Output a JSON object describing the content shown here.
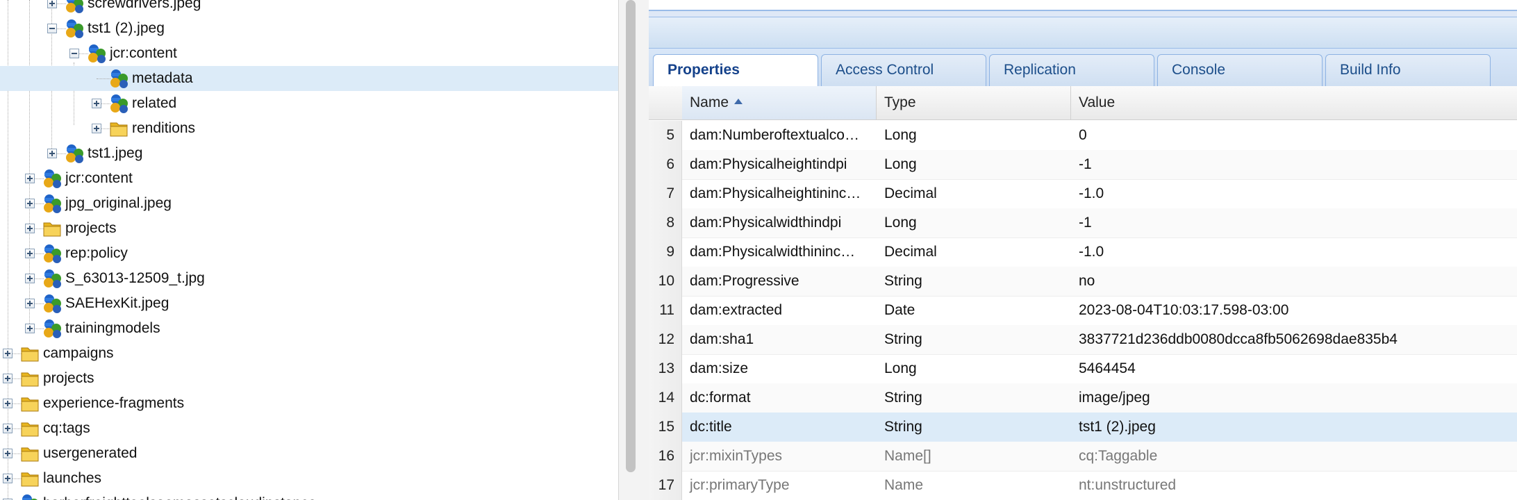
{
  "tree": [
    {
      "label": "screwdrivers.jpeg",
      "icon": "node-icon",
      "toggle": "plus"
    },
    {
      "label": "tst1 (2).jpeg",
      "icon": "node-icon",
      "toggle": "minus"
    },
    {
      "label": "jcr:content",
      "icon": "node-icon",
      "toggle": "minus"
    },
    {
      "label": "metadata",
      "icon": "node-icon",
      "toggle": "none",
      "selected": true
    },
    {
      "label": "related",
      "icon": "node-icon",
      "toggle": "plus"
    },
    {
      "label": "renditions",
      "icon": "folder-icon",
      "toggle": "plus"
    },
    {
      "label": "tst1.jpeg",
      "icon": "node-icon",
      "toggle": "plus"
    },
    {
      "label": "jcr:content",
      "icon": "node-icon",
      "toggle": "plus"
    },
    {
      "label": "jpg_original.jpeg",
      "icon": "node-icon",
      "toggle": "plus"
    },
    {
      "label": "projects",
      "icon": "folder-icon",
      "toggle": "plus"
    },
    {
      "label": "rep:policy",
      "icon": "node-icon",
      "toggle": "plus"
    },
    {
      "label": "S_63013-12509_t.jpg",
      "icon": "node-icon",
      "toggle": "plus"
    },
    {
      "label": "SAEHexKit.jpeg",
      "icon": "node-icon",
      "toggle": "plus"
    },
    {
      "label": "trainingmodels",
      "icon": "node-icon",
      "toggle": "plus"
    },
    {
      "label": "campaigns",
      "icon": "folder-icon",
      "toggle": "plus"
    },
    {
      "label": "projects",
      "icon": "folder-icon",
      "toggle": "plus"
    },
    {
      "label": "experience-fragments",
      "icon": "folder-icon",
      "toggle": "plus"
    },
    {
      "label": "cq:tags",
      "icon": "folder-icon",
      "toggle": "plus"
    },
    {
      "label": "usergenerated",
      "icon": "folder-icon",
      "toggle": "plus"
    },
    {
      "label": "launches",
      "icon": "folder-icon",
      "toggle": "plus"
    },
    {
      "label": "harborfreighttoolsaemassetscloudinstance",
      "icon": "node-icon",
      "toggle": "plus"
    }
  ],
  "tabs": [
    {
      "label": "Properties",
      "active": true
    },
    {
      "label": "Access Control",
      "active": false
    },
    {
      "label": "Replication",
      "active": false
    },
    {
      "label": "Console",
      "active": false
    },
    {
      "label": "Build Info",
      "active": false
    }
  ],
  "grid": {
    "columns": {
      "name": "Name",
      "type": "Type",
      "value": "Value"
    },
    "rows": [
      {
        "n": "5",
        "name": "dam:Numberoftextualco…",
        "type": "Long",
        "value": "0"
      },
      {
        "n": "6",
        "name": "dam:Physicalheightindpi",
        "type": "Long",
        "value": "-1"
      },
      {
        "n": "7",
        "name": "dam:Physicalheightininc…",
        "type": "Decimal",
        "value": "-1.0"
      },
      {
        "n": "8",
        "name": "dam:Physicalwidthindpi",
        "type": "Long",
        "value": "-1"
      },
      {
        "n": "9",
        "name": "dam:Physicalwidthininc…",
        "type": "Decimal",
        "value": "-1.0"
      },
      {
        "n": "10",
        "name": "dam:Progressive",
        "type": "String",
        "value": "no"
      },
      {
        "n": "11",
        "name": "dam:extracted",
        "type": "Date",
        "value": "2023-08-04T10:03:17.598-03:00"
      },
      {
        "n": "12",
        "name": "dam:sha1",
        "type": "String",
        "value": "3837721d236ddb0080dcca8fb5062698dae835b4"
      },
      {
        "n": "13",
        "name": "dam:size",
        "type": "Long",
        "value": "5464454"
      },
      {
        "n": "14",
        "name": "dc:format",
        "type": "String",
        "value": "image/jpeg"
      },
      {
        "n": "15",
        "name": "dc:title",
        "type": "String",
        "value": "tst1 (2).jpeg",
        "selected": true
      },
      {
        "n": "16",
        "name": "jcr:mixinTypes",
        "type": "Name[]",
        "value": "cq:Taggable",
        "dim": true
      },
      {
        "n": "17",
        "name": "jcr:primaryType",
        "type": "Name",
        "value": "nt:unstructured",
        "dim": true
      }
    ]
  },
  "colors": {
    "selection": "#dcebf8",
    "tab_text": "#15428b",
    "panel_border": "#99bbe8"
  }
}
